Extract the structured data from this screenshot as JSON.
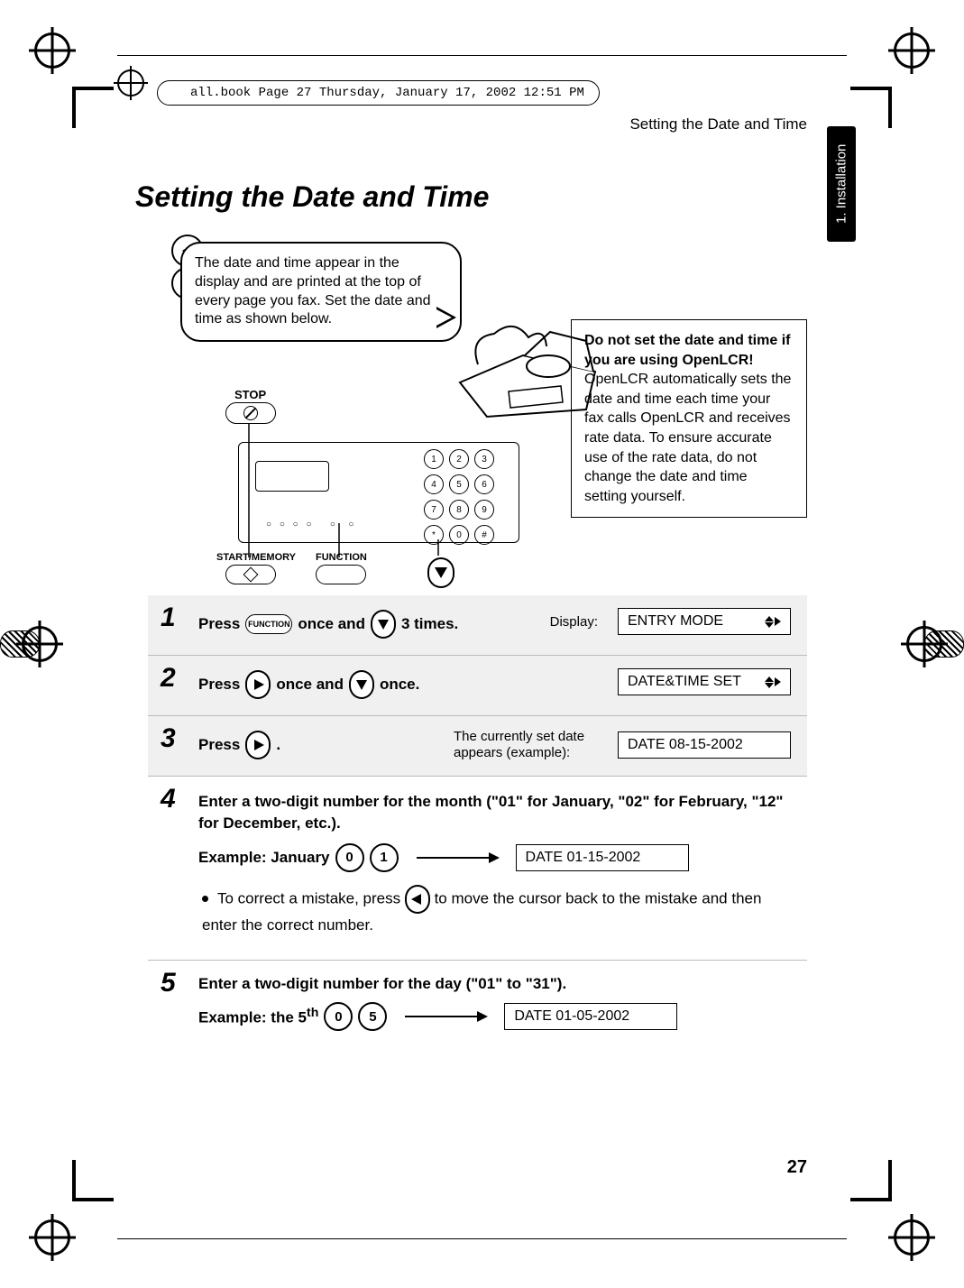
{
  "doc_runhead": "all.book  Page 27  Thursday, January 17, 2002  12:51 PM",
  "side_tab": "1. Installation",
  "running_head": "Setting the Date and Time",
  "title": "Setting the Date and Time",
  "speech": "The date and time appear in the display and are printed at the top of every page you fax. Set the date and time as shown below.",
  "notice_bold": "Do not set the date and time if you are using OpenLCR!",
  "notice_body": " OpenLCR automatically sets the date and time each time your fax calls OpenLCR and receives rate data. To ensure accurate use of the rate data, do not change the date and time setting yourself.",
  "labels": {
    "stop": "STOP",
    "start": "START/MEMORY",
    "function": "FUNCTION"
  },
  "keypad": [
    "1",
    "2",
    "3",
    "4",
    "5",
    "6",
    "7",
    "8",
    "9",
    "*",
    "0",
    "#"
  ],
  "steps": {
    "s1": {
      "pre": "Press ",
      "btn": "FUNCTION",
      "mid": " once and ",
      "post": " 3 times.",
      "display_label": "Display:",
      "display": "ENTRY MODE"
    },
    "s2": {
      "pre": "Press ",
      "mid": " once and ",
      "post": " once.",
      "display": "DATE&TIME SET"
    },
    "s3": {
      "pre": "Press ",
      "post": " .",
      "note": "The currently set date appears (example):",
      "display": "DATE 08-15-2002"
    },
    "s4": {
      "line1": "Enter a two-digit number for the month (\"01\" for January, \"02\" for February, \"12\" for December, etc.).",
      "example_label": "Example: January",
      "k1": "0",
      "k2": "1",
      "display": "DATE 01-15-2002",
      "bullet": "To correct a mistake, press ",
      "bullet_tail": " to move the cursor back to the mistake and then enter the correct number."
    },
    "s5": {
      "line1": "Enter a two-digit number for the day (\"01\" to \"31\").",
      "example_label": "Example: the 5",
      "example_sup": "th",
      "k1": "0",
      "k2": "5",
      "display": "DATE 01-05-2002"
    }
  },
  "page_number": "27"
}
